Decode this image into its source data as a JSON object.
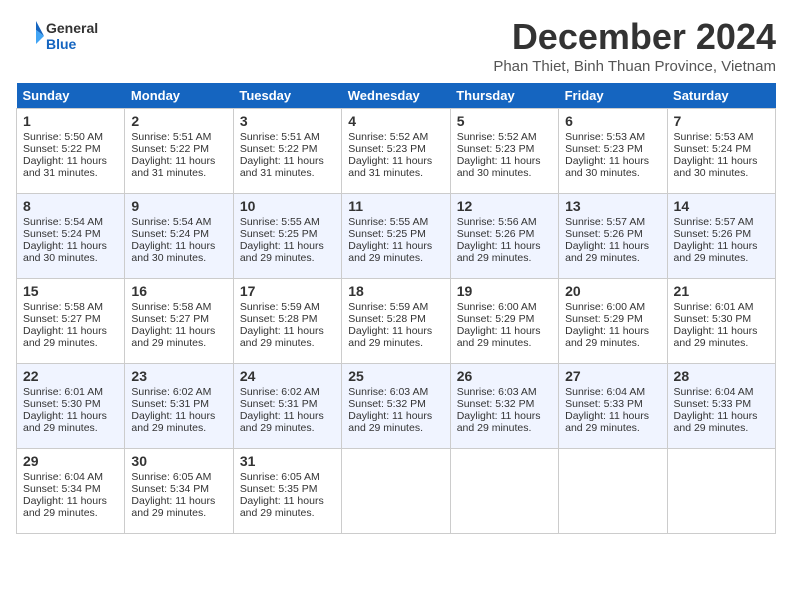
{
  "header": {
    "logo_line1": "General",
    "logo_line2": "Blue",
    "month_title": "December 2024",
    "subtitle": "Phan Thiet, Binh Thuan Province, Vietnam"
  },
  "days_of_week": [
    "Sunday",
    "Monday",
    "Tuesday",
    "Wednesday",
    "Thursday",
    "Friday",
    "Saturday"
  ],
  "weeks": [
    [
      {
        "day": 1,
        "sunrise": "5:50 AM",
        "sunset": "5:22 PM",
        "daylight": "11 hours and 31 minutes."
      },
      {
        "day": 2,
        "sunrise": "5:51 AM",
        "sunset": "5:22 PM",
        "daylight": "11 hours and 31 minutes."
      },
      {
        "day": 3,
        "sunrise": "5:51 AM",
        "sunset": "5:22 PM",
        "daylight": "11 hours and 31 minutes."
      },
      {
        "day": 4,
        "sunrise": "5:52 AM",
        "sunset": "5:23 PM",
        "daylight": "11 hours and 31 minutes."
      },
      {
        "day": 5,
        "sunrise": "5:52 AM",
        "sunset": "5:23 PM",
        "daylight": "11 hours and 30 minutes."
      },
      {
        "day": 6,
        "sunrise": "5:53 AM",
        "sunset": "5:23 PM",
        "daylight": "11 hours and 30 minutes."
      },
      {
        "day": 7,
        "sunrise": "5:53 AM",
        "sunset": "5:24 PM",
        "daylight": "11 hours and 30 minutes."
      }
    ],
    [
      {
        "day": 8,
        "sunrise": "5:54 AM",
        "sunset": "5:24 PM",
        "daylight": "11 hours and 30 minutes."
      },
      {
        "day": 9,
        "sunrise": "5:54 AM",
        "sunset": "5:24 PM",
        "daylight": "11 hours and 30 minutes."
      },
      {
        "day": 10,
        "sunrise": "5:55 AM",
        "sunset": "5:25 PM",
        "daylight": "11 hours and 29 minutes."
      },
      {
        "day": 11,
        "sunrise": "5:55 AM",
        "sunset": "5:25 PM",
        "daylight": "11 hours and 29 minutes."
      },
      {
        "day": 12,
        "sunrise": "5:56 AM",
        "sunset": "5:26 PM",
        "daylight": "11 hours and 29 minutes."
      },
      {
        "day": 13,
        "sunrise": "5:57 AM",
        "sunset": "5:26 PM",
        "daylight": "11 hours and 29 minutes."
      },
      {
        "day": 14,
        "sunrise": "5:57 AM",
        "sunset": "5:26 PM",
        "daylight": "11 hours and 29 minutes."
      }
    ],
    [
      {
        "day": 15,
        "sunrise": "5:58 AM",
        "sunset": "5:27 PM",
        "daylight": "11 hours and 29 minutes."
      },
      {
        "day": 16,
        "sunrise": "5:58 AM",
        "sunset": "5:27 PM",
        "daylight": "11 hours and 29 minutes."
      },
      {
        "day": 17,
        "sunrise": "5:59 AM",
        "sunset": "5:28 PM",
        "daylight": "11 hours and 29 minutes."
      },
      {
        "day": 18,
        "sunrise": "5:59 AM",
        "sunset": "5:28 PM",
        "daylight": "11 hours and 29 minutes."
      },
      {
        "day": 19,
        "sunrise": "6:00 AM",
        "sunset": "5:29 PM",
        "daylight": "11 hours and 29 minutes."
      },
      {
        "day": 20,
        "sunrise": "6:00 AM",
        "sunset": "5:29 PM",
        "daylight": "11 hours and 29 minutes."
      },
      {
        "day": 21,
        "sunrise": "6:01 AM",
        "sunset": "5:30 PM",
        "daylight": "11 hours and 29 minutes."
      }
    ],
    [
      {
        "day": 22,
        "sunrise": "6:01 AM",
        "sunset": "5:30 PM",
        "daylight": "11 hours and 29 minutes."
      },
      {
        "day": 23,
        "sunrise": "6:02 AM",
        "sunset": "5:31 PM",
        "daylight": "11 hours and 29 minutes."
      },
      {
        "day": 24,
        "sunrise": "6:02 AM",
        "sunset": "5:31 PM",
        "daylight": "11 hours and 29 minutes."
      },
      {
        "day": 25,
        "sunrise": "6:03 AM",
        "sunset": "5:32 PM",
        "daylight": "11 hours and 29 minutes."
      },
      {
        "day": 26,
        "sunrise": "6:03 AM",
        "sunset": "5:32 PM",
        "daylight": "11 hours and 29 minutes."
      },
      {
        "day": 27,
        "sunrise": "6:04 AM",
        "sunset": "5:33 PM",
        "daylight": "11 hours and 29 minutes."
      },
      {
        "day": 28,
        "sunrise": "6:04 AM",
        "sunset": "5:33 PM",
        "daylight": "11 hours and 29 minutes."
      }
    ],
    [
      {
        "day": 29,
        "sunrise": "6:04 AM",
        "sunset": "5:34 PM",
        "daylight": "11 hours and 29 minutes."
      },
      {
        "day": 30,
        "sunrise": "6:05 AM",
        "sunset": "5:34 PM",
        "daylight": "11 hours and 29 minutes."
      },
      {
        "day": 31,
        "sunrise": "6:05 AM",
        "sunset": "5:35 PM",
        "daylight": "11 hours and 29 minutes."
      },
      null,
      null,
      null,
      null
    ]
  ]
}
